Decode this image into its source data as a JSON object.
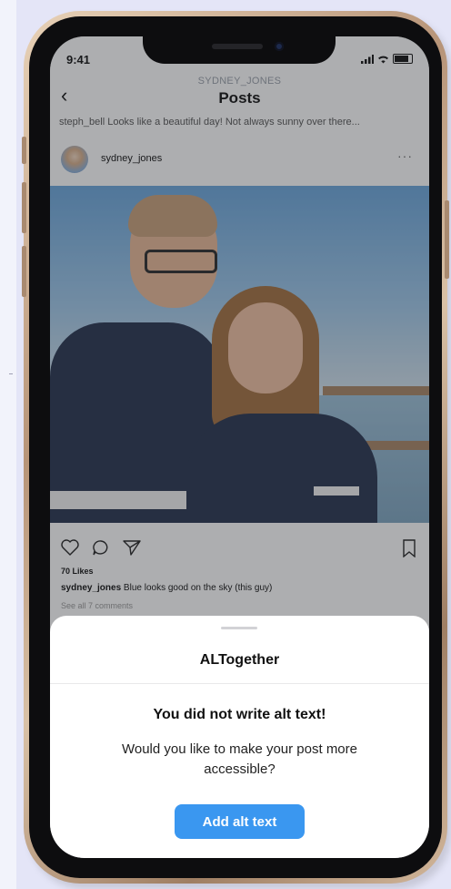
{
  "status_bar": {
    "time": "9:41"
  },
  "nav": {
    "subtitle": "SYDNEY_JONES",
    "title": "Posts",
    "back_glyph": "‹"
  },
  "previous_post": {
    "caption": "steph_bell Looks like a beautiful day! Not always sunny over there..."
  },
  "post": {
    "username": "sydney_jones",
    "more_glyph": "···",
    "likes": "70 Likes",
    "caption_user": "sydney_jones",
    "caption_text": " Blue looks good on the sky (this guy)",
    "comments_link": "See all 7 comments",
    "icons": [
      "heart-icon",
      "comment-icon",
      "send-icon",
      "bookmark-icon"
    ]
  },
  "sheet": {
    "title": "ALTogether",
    "heading": "You did not write alt text!",
    "body": "Would you like to make your post more accessible?",
    "button_label": "Add alt text"
  },
  "colors": {
    "accent": "#3a97f0",
    "background": "#e4e5f7",
    "phone_frame": "#b79478"
  }
}
